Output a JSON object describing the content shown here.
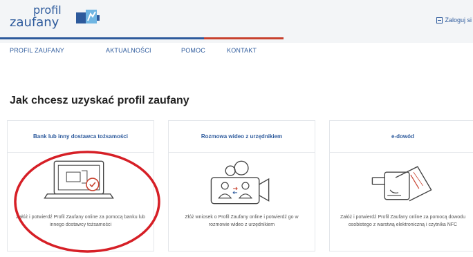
{
  "header": {
    "logo_line1": "profil",
    "logo_line2": "zaufany",
    "login_label": "Zaloguj si"
  },
  "nav": {
    "items": [
      {
        "label": "PROFIL ZAUFANY"
      },
      {
        "label": "AKTUALNOŚCI"
      },
      {
        "label": "POMOC"
      },
      {
        "label": "KONTAKT"
      }
    ]
  },
  "main": {
    "title": "Jak chcesz uzyskać profil zaufany",
    "cards": [
      {
        "title": "Bank lub inny dostawca tożsamości",
        "icon": "laptop-verify-icon",
        "description": "Załóż i potwierdź Profil Zaufany online za pomocą banku lub innego dostawcy tożsamości"
      },
      {
        "title": "Rozmowa wideo z urzędnikiem",
        "icon": "video-call-icon",
        "description": "Złóż wniosek o Profil Zaufany online i potwierdź go w rozmowie wideo z urzędnikiem"
      },
      {
        "title": "e-dowód",
        "icon": "e-id-card-icon",
        "description": "Załóż i potwierdź Profil Zaufany online za pomocą dowodu osobistego z warstwą elektroniczną i czytnika NFC"
      }
    ]
  },
  "colors": {
    "brand_blue": "#2d5a9c",
    "accent_red": "#c8412e",
    "highlight_ring": "#d61f26"
  }
}
